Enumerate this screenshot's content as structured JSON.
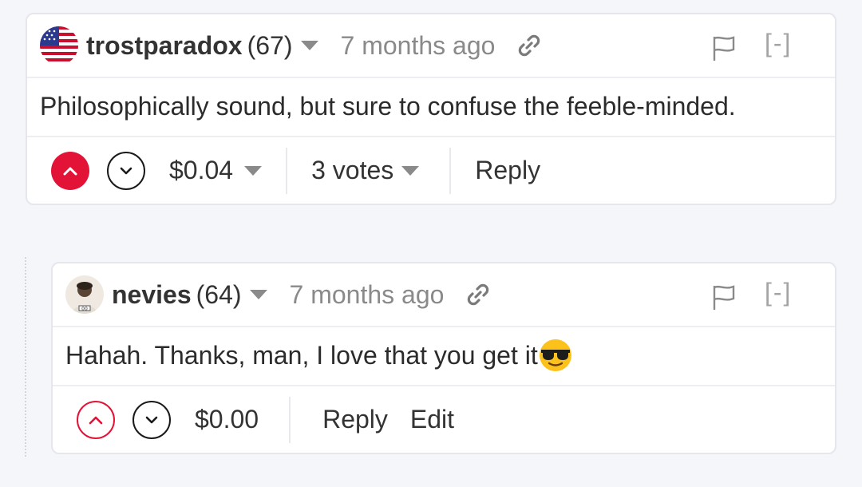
{
  "comments": [
    {
      "author": "trostparadox",
      "reputation": "(67)",
      "timestamp": "7 months ago",
      "collapse_label": "[-]",
      "body": "Philosophically sound, but sure to confuse the feeble-minded.",
      "upvoted": true,
      "payout": "$0.04",
      "votes": "3 votes",
      "reply_label": "Reply"
    },
    {
      "author": "nevies",
      "reputation": "(64)",
      "timestamp": "7 months ago",
      "collapse_label": "[-]",
      "body": "Hahah. Thanks, man, I love that you get it",
      "body_emoji": "smiling-face-with-sunglasses",
      "upvoted": false,
      "payout": "$0.00",
      "reply_label": "Reply",
      "edit_label": "Edit"
    }
  ],
  "colors": {
    "upvote_red": "#e31337",
    "muted_gray": "#8a8a8a",
    "background": "#f5f6fa"
  }
}
